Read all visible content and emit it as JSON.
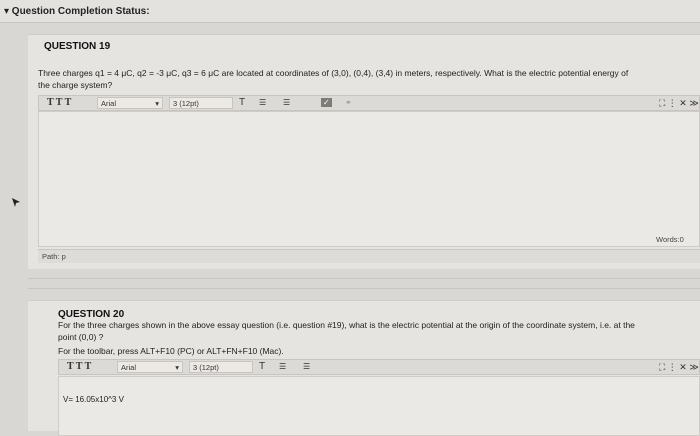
{
  "header": {
    "status_title": "▾ Question Completion Status:"
  },
  "q19": {
    "heading": "QUESTION 19",
    "text_line1": "Three charges q1 = 4 μC, q2 = -3 μC, q3 = 6 μC are located at coordinates of (3,0), (0,4), (3,4) in meters, respectively. What is the electric potential energy of",
    "text_line2": "the charge system?",
    "toolbar": {
      "format_buttons": "T T T",
      "font_select": "Arial",
      "size_select": "3 (12pt)",
      "text_color": "T",
      "list1": "☰",
      "list2": "☰",
      "check": "✓",
      "link": "⚭"
    },
    "editor_value": "",
    "path_label": "Path: p",
    "words_label": "Words:0"
  },
  "q20": {
    "heading": "QUESTION 20",
    "text_line1": "For the three charges shown in the above essay question (i.e. question #19), what is the electric potential at the origin of the coordinate system, i.e. at the",
    "text_line2": "point (0,0) ?",
    "toolbar_hint": "For the toolbar, press ALT+F10 (PC) or ALT+FN+F10 (Mac).",
    "toolbar": {
      "format_buttons": "T T T",
      "font_select": "Arial",
      "size_select": "3 (12pt)",
      "text_color": "T",
      "list1": "☰",
      "list2": "☰"
    },
    "answer_value": "V= 16.05x10^3 V"
  }
}
